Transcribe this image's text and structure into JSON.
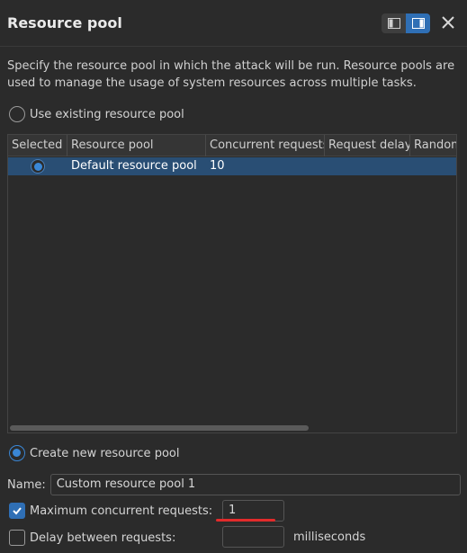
{
  "header": {
    "title": "Resource pool",
    "layout_toggle": [
      "layout-left-icon",
      "layout-right-icon"
    ],
    "close": "close-icon"
  },
  "description": "Specify the resource pool in which the attack will be run. Resource pools are used to manage the usage of system resources across multiple tasks.",
  "use_existing": {
    "label": "Use existing resource pool",
    "checked": false
  },
  "table": {
    "columns": [
      "Selected",
      "Resource pool",
      "Concurrent requests",
      "Request delay",
      "Random"
    ],
    "rows": [
      {
        "selected": true,
        "resource_pool": "Default resource pool",
        "concurrent_requests": "10",
        "request_delay": "",
        "random": ""
      }
    ]
  },
  "create_new": {
    "label": "Create new resource pool",
    "checked": true
  },
  "name_field": {
    "label": "Name:",
    "value": "Custom resource pool 1"
  },
  "max_concurrent": {
    "label": "Maximum concurrent requests:",
    "checked": true,
    "value": "1"
  },
  "delay": {
    "label": "Delay between requests:",
    "checked": false,
    "value": "",
    "unit": "milliseconds"
  },
  "colors": {
    "accent": "#2f6fb5",
    "selected_row": "#294e74",
    "annotation": "#e22b2b"
  }
}
